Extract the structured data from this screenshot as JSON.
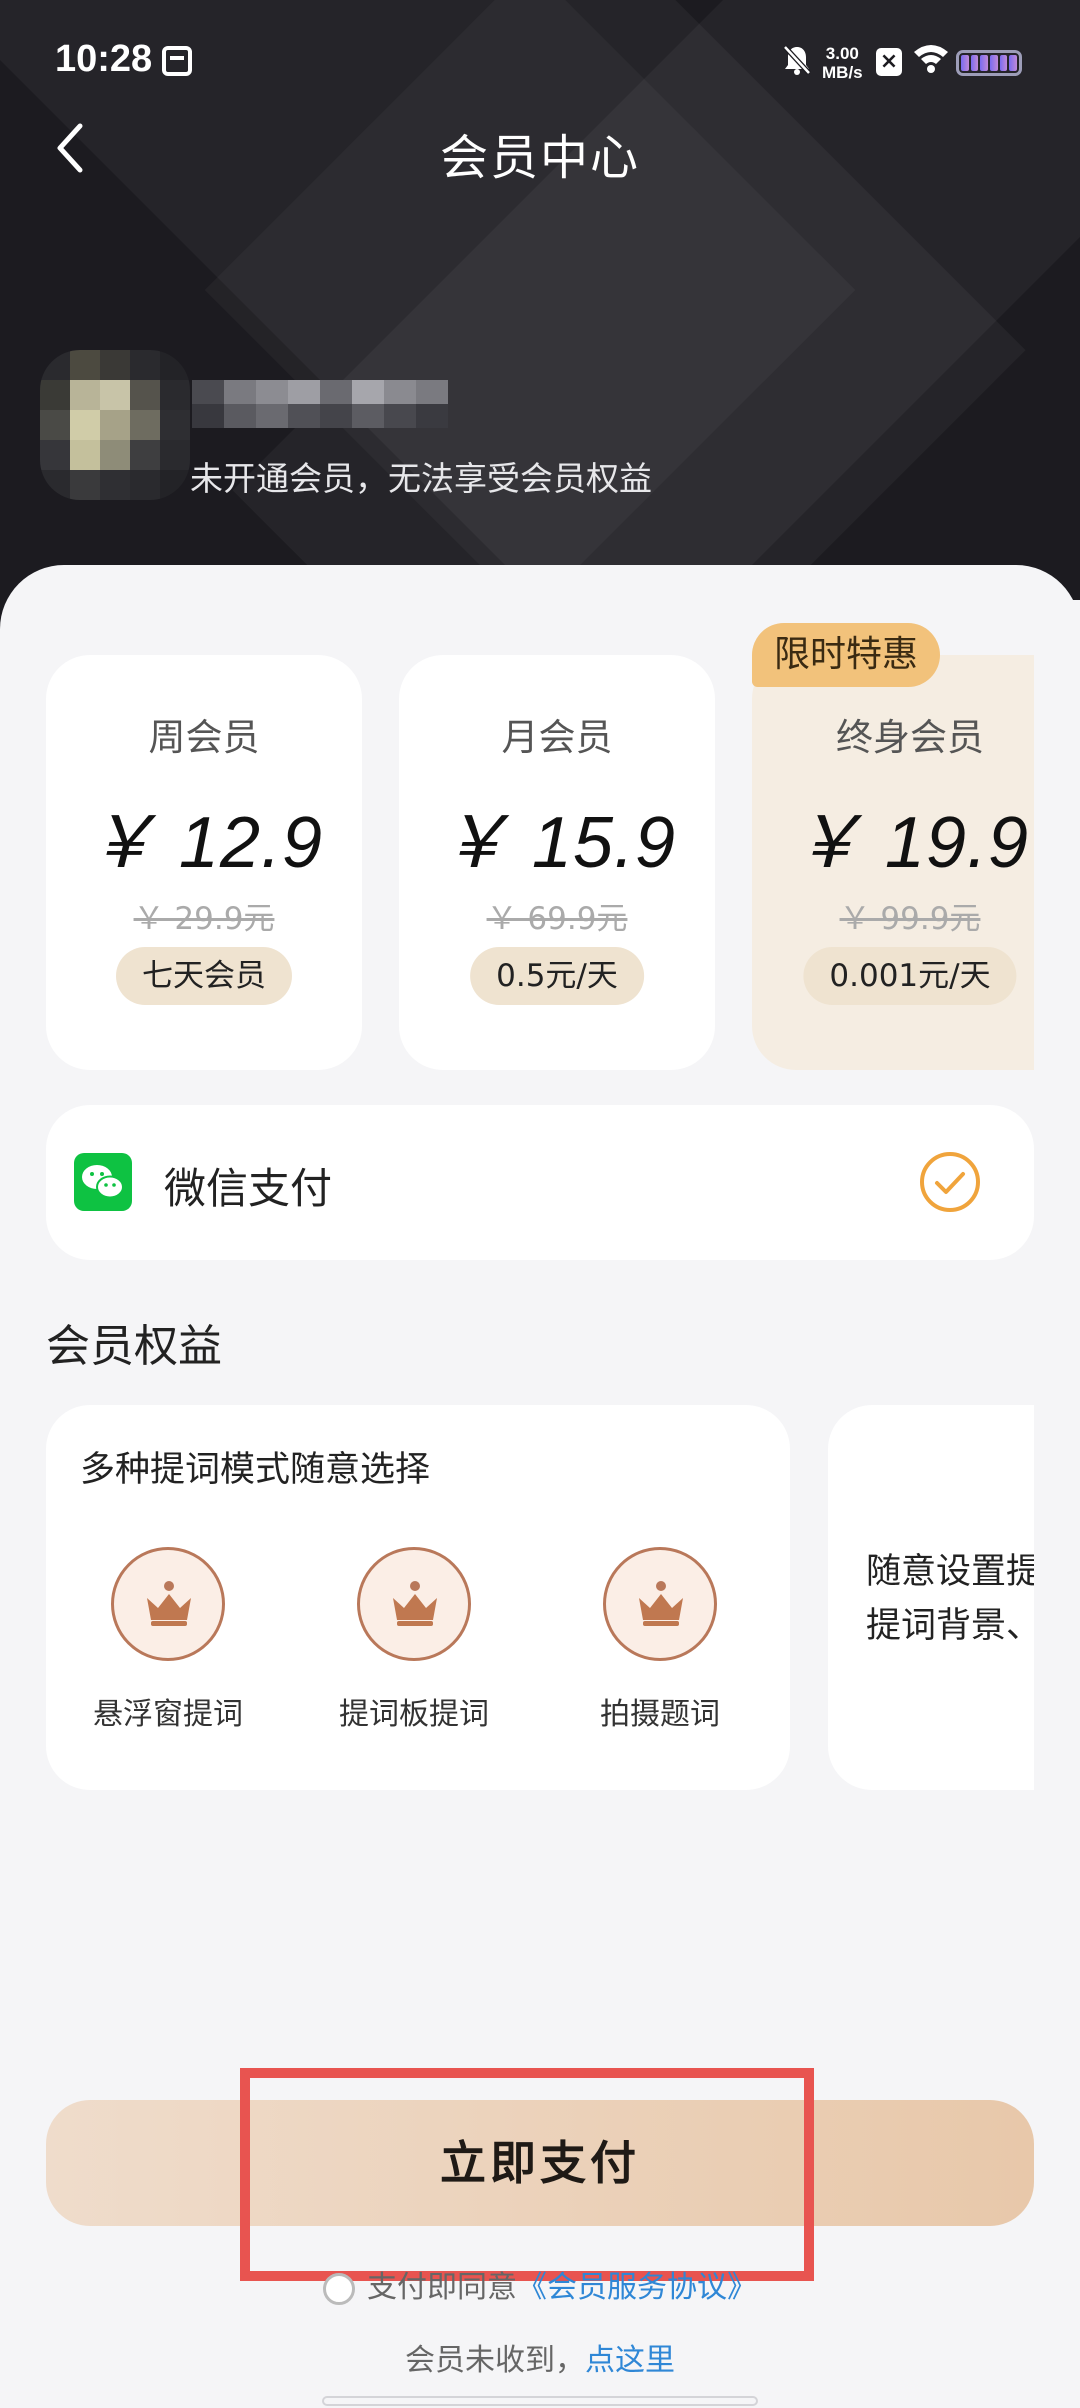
{
  "status_bar": {
    "time": "10:28",
    "net_speed_value": "3.00",
    "net_speed_unit": "MB/s"
  },
  "header": {
    "title": "会员中心"
  },
  "user": {
    "subtitle": "未开通会员，无法享受会员权益"
  },
  "plans": [
    {
      "name": "周会员",
      "price": "￥ 12.9",
      "original": "￥ 29.9元",
      "tag": "七天会员"
    },
    {
      "name": "月会员",
      "price": "￥ 15.9",
      "original": "￥ 69.9元",
      "tag": "0.5元/天"
    },
    {
      "name": "终身会员",
      "price": "￥ 19.9",
      "original": "￥ 99.9元",
      "tag": "0.001元/天",
      "badge": "限时特惠"
    }
  ],
  "payment": {
    "method_label": "微信支付",
    "selected": true
  },
  "benefits": {
    "section_title": "会员权益",
    "card1_title": "多种提词模式随意选择",
    "features": [
      {
        "icon": "crown-icon",
        "label": "悬浮窗提词"
      },
      {
        "icon": "crown-icon",
        "label": "提词板提词"
      },
      {
        "icon": "crown-icon",
        "label": "拍摄题词"
      }
    ],
    "card2_line1": "随意设置提",
    "card2_line2": "提词背景、"
  },
  "footer": {
    "pay_button": "立即支付",
    "agreement_prefix": "支付即同意",
    "agreement_link": "《会员服务协议》",
    "notice_prefix": "会员未收到，",
    "notice_link": "点这里"
  },
  "colors": {
    "accent": "#f0a43c",
    "badge": "#f2c27b",
    "pay_button": "#e8c8aa",
    "highlight_box": "#e85450",
    "wechat": "#0ec242",
    "link": "#2f87d6"
  }
}
